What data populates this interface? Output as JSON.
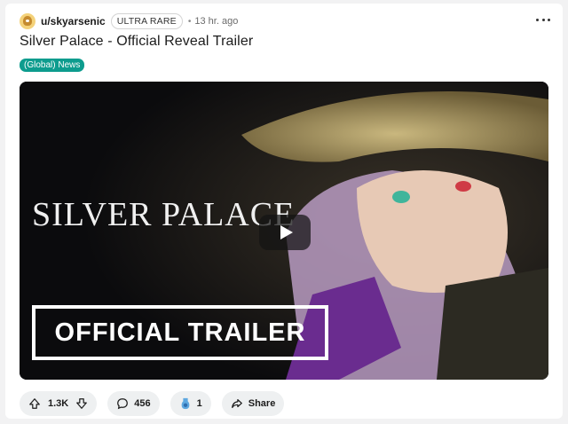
{
  "post": {
    "username": "u/skyarsenic",
    "flair": "ULTRA RARE",
    "dot": "•",
    "time": "13 hr. ago",
    "title": "Silver Palace - Official Reveal Trailer",
    "tag": "(Global) News"
  },
  "video": {
    "logo_text": "SILVER PALACE",
    "trailer_text": "OFFICIAL TRAILER"
  },
  "actions": {
    "upvotes": "1.3K",
    "comments": "456",
    "awards": "1",
    "share": "Share"
  },
  "icons": [
    "avatar",
    "more-icon",
    "play-icon",
    "upvote-icon",
    "downvote-icon",
    "comment-icon",
    "award-icon",
    "share-icon"
  ],
  "colors": {
    "tag_bg": "#0d9c8e",
    "action_bg": "#eef0f1",
    "video_bg": "#0b0b0d"
  }
}
